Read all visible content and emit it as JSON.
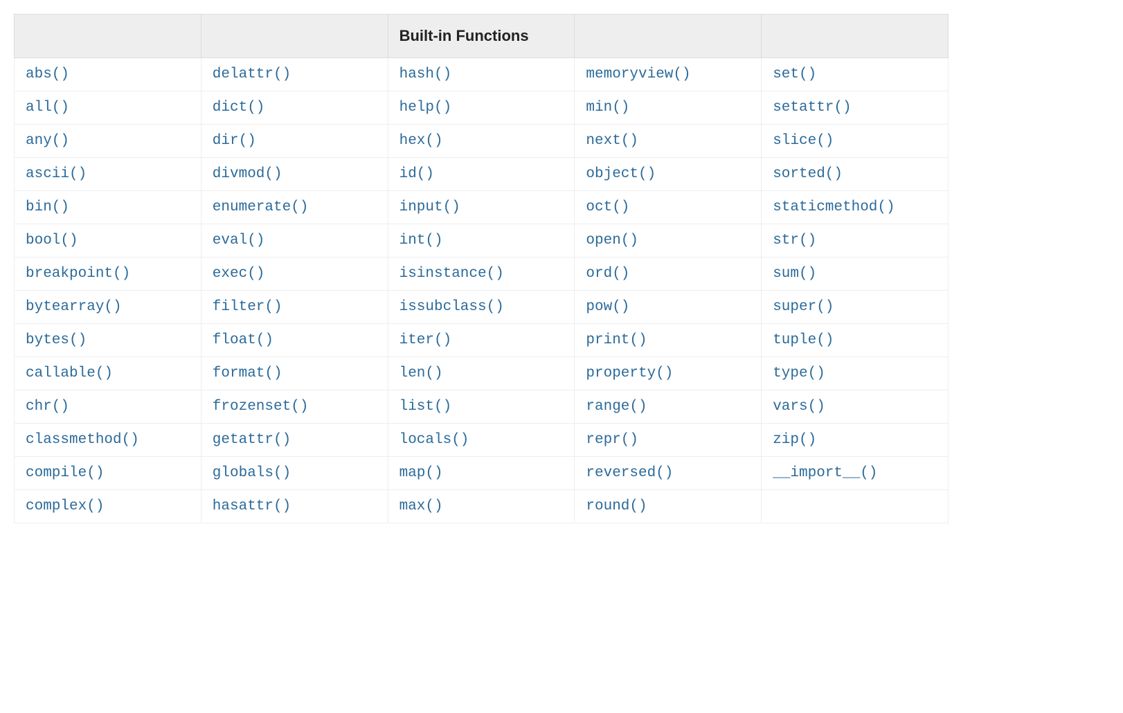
{
  "table": {
    "header": [
      "",
      "",
      "Built-in Functions",
      "",
      ""
    ],
    "rows": [
      [
        "abs()",
        "delattr()",
        "hash()",
        "memoryview()",
        "set()"
      ],
      [
        "all()",
        "dict()",
        "help()",
        "min()",
        "setattr()"
      ],
      [
        "any()",
        "dir()",
        "hex()",
        "next()",
        "slice()"
      ],
      [
        "ascii()",
        "divmod()",
        "id()",
        "object()",
        "sorted()"
      ],
      [
        "bin()",
        "enumerate()",
        "input()",
        "oct()",
        "staticmethod()"
      ],
      [
        "bool()",
        "eval()",
        "int()",
        "open()",
        "str()"
      ],
      [
        "breakpoint()",
        "exec()",
        "isinstance()",
        "ord()",
        "sum()"
      ],
      [
        "bytearray()",
        "filter()",
        "issubclass()",
        "pow()",
        "super()"
      ],
      [
        "bytes()",
        "float()",
        "iter()",
        "print()",
        "tuple()"
      ],
      [
        "callable()",
        "format()",
        "len()",
        "property()",
        "type()"
      ],
      [
        "chr()",
        "frozenset()",
        "list()",
        "range()",
        "vars()"
      ],
      [
        "classmethod()",
        "getattr()",
        "locals()",
        "repr()",
        "zip()"
      ],
      [
        "compile()",
        "globals()",
        "map()",
        "reversed()",
        "__import__()"
      ],
      [
        "complex()",
        "hasattr()",
        "max()",
        "round()",
        ""
      ]
    ]
  }
}
